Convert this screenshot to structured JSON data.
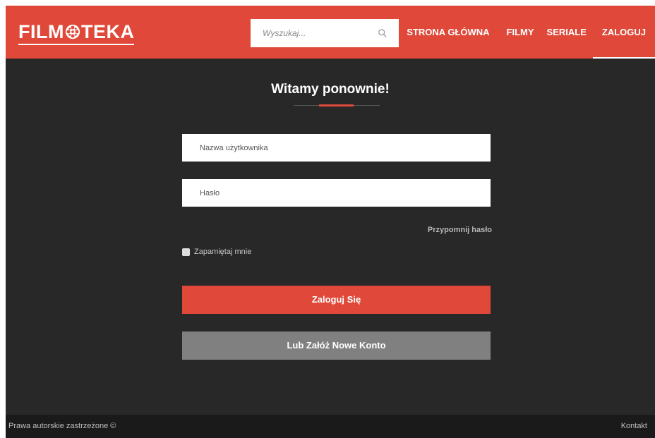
{
  "header": {
    "logo": {
      "before": "FILM",
      "after": "TEKA"
    },
    "search": {
      "placeholder": "Wyszukaj..."
    },
    "nav": [
      {
        "label": "STRONA GŁÓWNA"
      },
      {
        "label": "FILMY"
      },
      {
        "label": "SERIALE"
      },
      {
        "label": "ZALOGUJ"
      }
    ]
  },
  "main": {
    "title": "Witamy ponownie!",
    "username_placeholder": "Nazwa użytkownika",
    "password_placeholder": "Hasło",
    "remind_password": "Przypomnij hasło",
    "remember_me": "Zapamiętaj mnie",
    "login_button": "Zaloguj Się",
    "register_button": "Lub Załóż Nowe Konto"
  },
  "footer": {
    "copyright": "Prawa autorskie zastrzeżone ©",
    "contact": "Kontakt"
  },
  "colors": {
    "accent": "#e0493a",
    "background": "#282828",
    "footer": "#1a1a1a",
    "secondary_button": "#808080"
  }
}
